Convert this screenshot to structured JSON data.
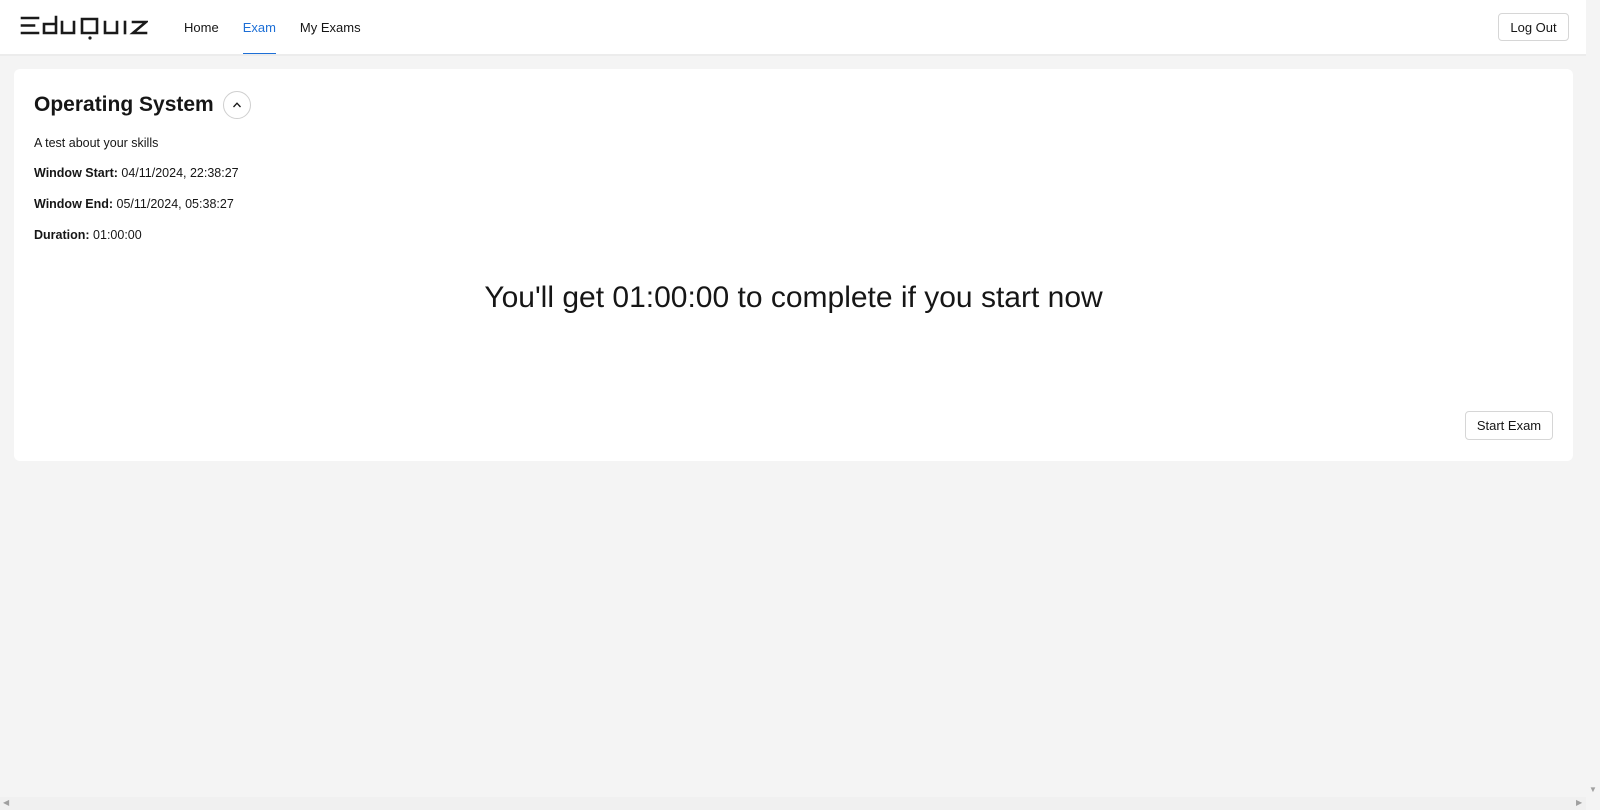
{
  "header": {
    "logo_text": "EduQuiz",
    "nav": [
      {
        "label": "Home",
        "active": false
      },
      {
        "label": "Exam",
        "active": true
      },
      {
        "label": "My Exams",
        "active": false
      }
    ],
    "logout_label": "Log Out",
    "accent_color": "#1d6fd6"
  },
  "exam": {
    "title": "Operating System",
    "collapse_icon": "chevron-up-icon",
    "description": "A test about your skills",
    "window_start_label": "Window Start:",
    "window_start_value": "04/11/2024, 22:38:27",
    "window_end_label": "Window End:",
    "window_end_value": "05/11/2024, 05:38:27",
    "duration_label": "Duration:",
    "duration_value": "01:00:00",
    "message": "You'll get 01:00:00 to complete if you start now",
    "start_label": "Start Exam"
  }
}
